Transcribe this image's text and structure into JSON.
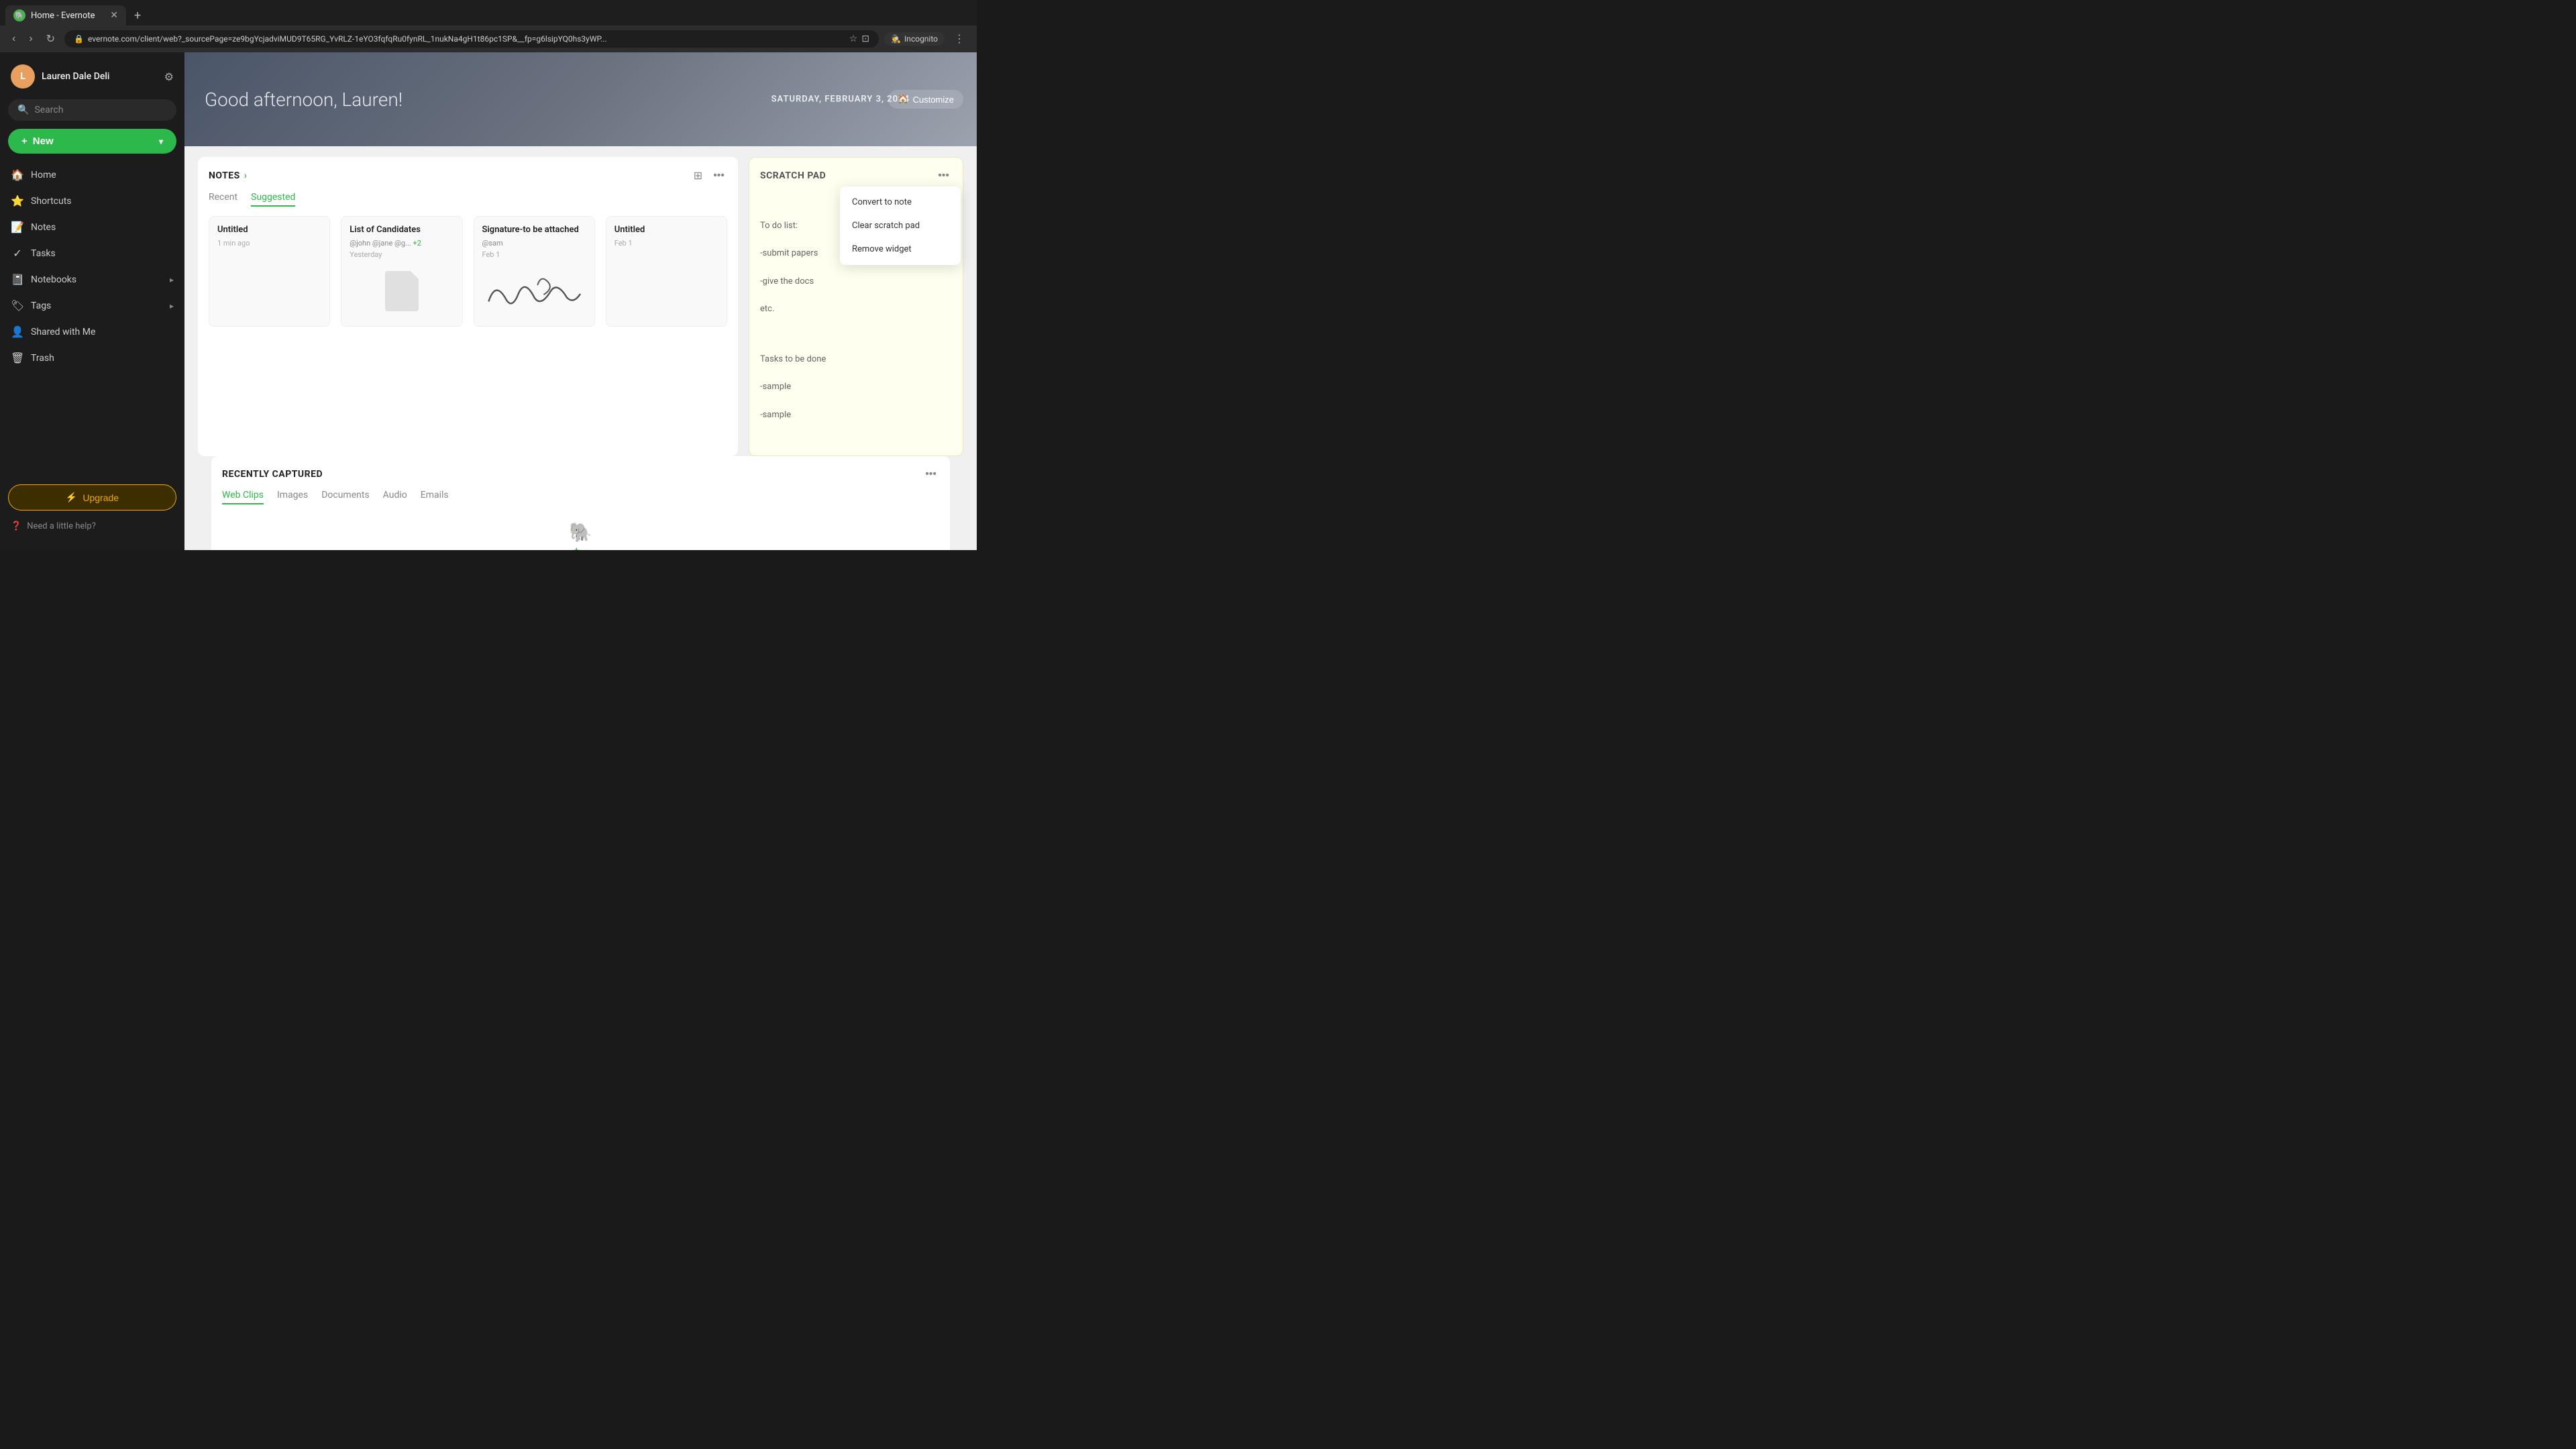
{
  "browser": {
    "tab_title": "Home - Evernote",
    "tab_favicon": "🐘",
    "url": "evernote.com/client/web?_sourcePage=ze9bgYcjadviMUD9T65RG_YvRLZ-1eYO3fqfqRu0fynRL_1nukNa4gH1t86pc1SP&__fp=g6lsipYQ0hs3yWP...",
    "new_tab_label": "+",
    "incognito_label": "Incognito",
    "incognito_icon": "🕵"
  },
  "sidebar": {
    "profile_name": "Lauren Dale Deli",
    "profile_initial": "L",
    "search_placeholder": "Search",
    "new_button": "New",
    "nav_items": [
      {
        "label": "Home",
        "icon": "🏠"
      },
      {
        "label": "Shortcuts",
        "icon": "⭐"
      },
      {
        "label": "Notes",
        "icon": "📝"
      },
      {
        "label": "Tasks",
        "icon": "✓"
      },
      {
        "label": "Notebooks",
        "icon": "📓",
        "expandable": true
      },
      {
        "label": "Tags",
        "icon": "🏷",
        "expandable": true
      },
      {
        "label": "Shared with Me",
        "icon": "👤"
      },
      {
        "label": "Trash",
        "icon": "🗑"
      }
    ],
    "upgrade_btn": "Upgrade",
    "help_text": "Need a little help?"
  },
  "hero": {
    "greeting": "Good afternoon, Lauren!",
    "date": "SATURDAY, FEBRUARY 3, 2024",
    "customize_label": "Customize"
  },
  "notes_widget": {
    "title": "NOTES",
    "tabs": [
      "Recent",
      "Suggested"
    ],
    "active_tab": "Suggested",
    "notes": [
      {
        "title": "Untitled",
        "tags": "",
        "date": "1 min ago",
        "has_file": false
      },
      {
        "title": "List of Candidates",
        "tags": "@john @jane @g...",
        "extra_tags": "+2",
        "date": "Yesterday",
        "has_file": true
      },
      {
        "title": "Signature-to be attached",
        "tags": "@sam",
        "date": "Feb 1",
        "has_signature": true
      },
      {
        "title": "Untitled",
        "tags": "",
        "date": "Feb 1",
        "has_file": false
      }
    ]
  },
  "scratch_pad": {
    "title": "SCRATCH PAD",
    "content_line1": "To do list:",
    "content_line2": "-submit papers",
    "content_line3": "-give the docs",
    "content_line4": "etc.",
    "content_line5": "",
    "content_line6": "Tasks to be done",
    "content_line7": "-sample",
    "content_line8": "-sample"
  },
  "scratch_menu": {
    "items": [
      "Convert to note",
      "Clear scratch pad",
      "Remove widget"
    ]
  },
  "recently_captured": {
    "title": "RECENTLY CAPTURED",
    "tabs": [
      "Web Clips",
      "Images",
      "Documents",
      "Audio",
      "Emails"
    ],
    "active_tab": "Web Clips"
  }
}
